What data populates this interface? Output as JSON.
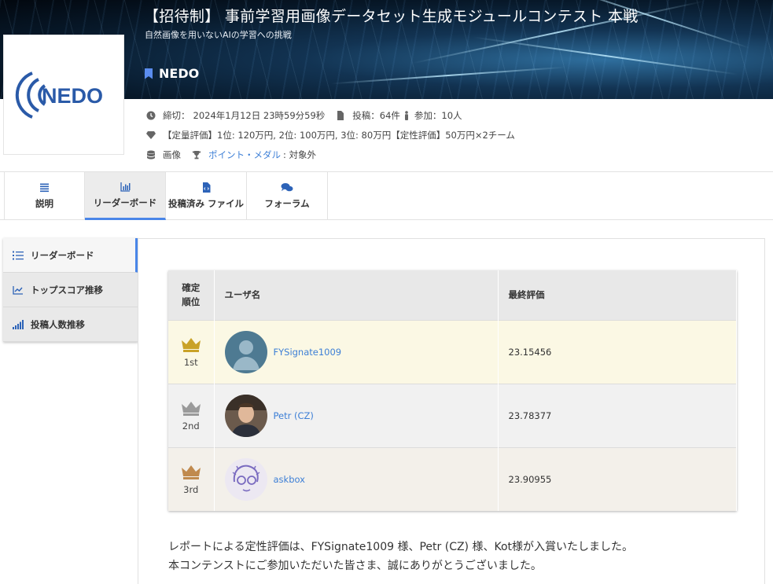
{
  "header": {
    "title": "【招待制】 事前学習用画像データセット生成モジュールコンテスト 本戦",
    "subtitle": "自然画像を用いないAIの学習への挑戦",
    "org": "NEDO",
    "logo_text": "NEDO"
  },
  "meta": {
    "deadline_label": "締切：",
    "deadline": "2024年1月12日 23時59分59秒",
    "submissions": "投稿：64件",
    "participants": "参加：10人",
    "prize": "【定量評価】1位: 120万円, 2位: 100万円, 3位: 80万円【定性評価】50万円×2チーム",
    "category": "画像",
    "points_link": "ポイント・メダル",
    "points_value": ": 対象外"
  },
  "tabs": [
    {
      "label": "説明",
      "icon": "list-icon"
    },
    {
      "label": "リーダーボード",
      "icon": "bar-chart-icon"
    },
    {
      "label": "投稿済み ファイル",
      "icon": "file-code-icon"
    },
    {
      "label": "フォーラム",
      "icon": "comments-icon"
    }
  ],
  "sidemenu": [
    {
      "label": "リーダーボード",
      "icon": "ranking-list-icon"
    },
    {
      "label": "トップスコア推移",
      "icon": "line-chart-icon"
    },
    {
      "label": "投稿人数推移",
      "icon": "signal-bars-icon"
    }
  ],
  "leaderboard": {
    "headers": {
      "rank": "確定順位",
      "rank_line1": "確定",
      "rank_line2": "順位",
      "user": "ユーザ名",
      "score": "最終評価"
    },
    "rows": [
      {
        "rank": "1st",
        "user": "FYSignate1009",
        "score": "23.15456",
        "crown": "gold-crown-icon"
      },
      {
        "rank": "2nd",
        "user": "Petr (CZ)",
        "score": "23.78377",
        "crown": "silver-crown-icon"
      },
      {
        "rank": "3rd",
        "user": "askbox",
        "score": "23.90955",
        "crown": "bronze-crown-icon"
      }
    ]
  },
  "footer": {
    "line1": "レポートによる定性評価は、FYSignate1009 様、Petr (CZ) 様、Kot様が入賞いたしました。",
    "line2": "本コンテンストにご参加いただいた皆さま、誠にありがとうございました。"
  },
  "colors": {
    "accent": "#4a86e8",
    "link": "#3d7fd6",
    "gold": "#c9a227",
    "silver": "#9a9a9a",
    "bronze": "#c08a4e",
    "nedo_blue": "#2a5aa8"
  }
}
